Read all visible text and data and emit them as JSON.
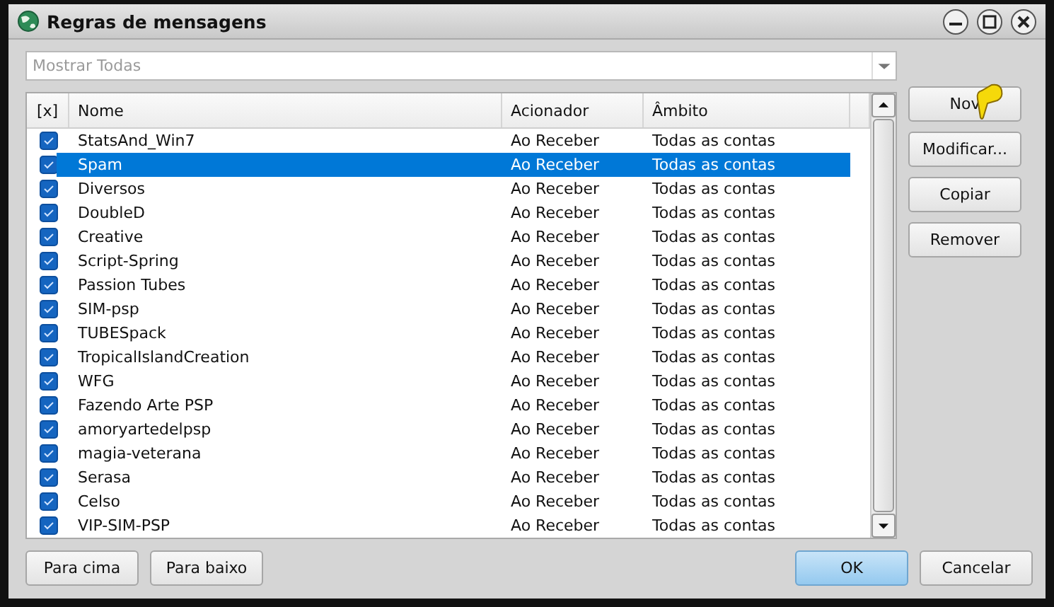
{
  "window": {
    "title": "Regras de mensagens"
  },
  "filter": {
    "value": "Mostrar Todas"
  },
  "table": {
    "columns": [
      "[x]",
      "Nome",
      "Acionador",
      "Âmbito"
    ],
    "rows": [
      {
        "checked": true,
        "selected": false,
        "name": "StatsAnd_Win7",
        "trigger": "Ao Receber",
        "scope": "Todas as contas"
      },
      {
        "checked": true,
        "selected": true,
        "name": "Spam",
        "trigger": "Ao Receber",
        "scope": "Todas as contas"
      },
      {
        "checked": true,
        "selected": false,
        "name": "Diversos",
        "trigger": "Ao Receber",
        "scope": "Todas as contas"
      },
      {
        "checked": true,
        "selected": false,
        "name": "DoubleD",
        "trigger": "Ao Receber",
        "scope": "Todas as contas"
      },
      {
        "checked": true,
        "selected": false,
        "name": "Creative",
        "trigger": "Ao Receber",
        "scope": "Todas as contas"
      },
      {
        "checked": true,
        "selected": false,
        "name": "Script-Spring",
        "trigger": "Ao Receber",
        "scope": "Todas as contas"
      },
      {
        "checked": true,
        "selected": false,
        "name": "Passion Tubes",
        "trigger": "Ao Receber",
        "scope": "Todas as contas"
      },
      {
        "checked": true,
        "selected": false,
        "name": "SIM-psp",
        "trigger": "Ao Receber",
        "scope": "Todas as contas"
      },
      {
        "checked": true,
        "selected": false,
        "name": "TUBESpack",
        "trigger": "Ao Receber",
        "scope": "Todas as contas"
      },
      {
        "checked": true,
        "selected": false,
        "name": "TropicalIslandCreation",
        "trigger": "Ao Receber",
        "scope": "Todas as contas"
      },
      {
        "checked": true,
        "selected": false,
        "name": "WFG",
        "trigger": "Ao Receber",
        "scope": "Todas as contas"
      },
      {
        "checked": true,
        "selected": false,
        "name": "Fazendo Arte PSP",
        "trigger": "Ao Receber",
        "scope": "Todas as contas"
      },
      {
        "checked": true,
        "selected": false,
        "name": "amoryartedelpsp",
        "trigger": "Ao Receber",
        "scope": "Todas as contas"
      },
      {
        "checked": true,
        "selected": false,
        "name": "magia-veterana",
        "trigger": "Ao Receber",
        "scope": "Todas as contas"
      },
      {
        "checked": true,
        "selected": false,
        "name": "Serasa",
        "trigger": "Ao Receber",
        "scope": "Todas as contas"
      },
      {
        "checked": true,
        "selected": false,
        "name": "Celso",
        "trigger": "Ao Receber",
        "scope": "Todas as contas"
      },
      {
        "checked": true,
        "selected": false,
        "name": "VIP-SIM-PSP",
        "trigger": "Ao Receber",
        "scope": "Todas as contas"
      }
    ]
  },
  "side_buttons": [
    "Nov",
    "Modificar...",
    "Copiar",
    "Remover"
  ],
  "bottom_left_buttons": [
    "Para cima",
    "Para baixo"
  ],
  "bottom_right_buttons": [
    {
      "label": "OK",
      "default": true
    },
    {
      "label": "Cancelar",
      "default": false
    }
  ]
}
